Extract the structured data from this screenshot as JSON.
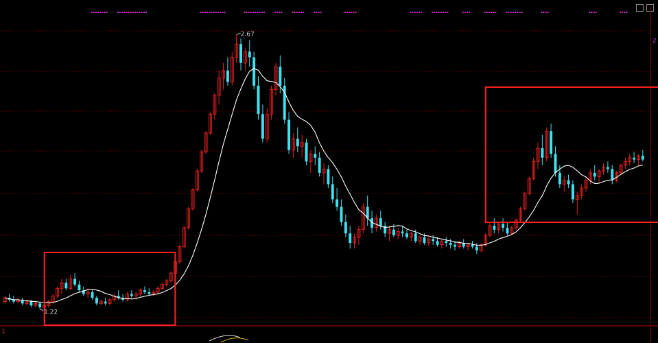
{
  "colors": {
    "background": "#000000",
    "up": "#e02020",
    "down": "#3fe0f0",
    "ma": "#ffffff",
    "grid": "#7a0000",
    "highlight_box": "#ff2020",
    "signal_dots": "#d030d0"
  },
  "chart_data": {
    "type": "candlestick",
    "annotations": {
      "high_label": "2.67",
      "low_label": "1.22"
    },
    "ylim": [
      1.15,
      2.78
    ],
    "highlight_boxes": [
      {
        "label": "",
        "x_range_start": 10,
        "x_range_end": 38
      },
      {
        "label": "",
        "x_range_start": 111,
        "x_range_end": 150
      }
    ],
    "corner_marks": {
      "bottom_left": "1",
      "right_edge": "2"
    },
    "ohlc": [
      [
        1.26,
        1.29,
        1.25,
        1.28
      ],
      [
        1.28,
        1.3,
        1.26,
        1.27
      ],
      [
        1.27,
        1.29,
        1.25,
        1.26
      ],
      [
        1.26,
        1.28,
        1.25,
        1.27
      ],
      [
        1.27,
        1.28,
        1.24,
        1.25
      ],
      [
        1.25,
        1.27,
        1.24,
        1.26
      ],
      [
        1.26,
        1.27,
        1.23,
        1.24
      ],
      [
        1.24,
        1.26,
        1.23,
        1.25
      ],
      [
        1.25,
        1.26,
        1.22,
        1.23
      ],
      [
        1.23,
        1.25,
        1.22,
        1.24
      ],
      [
        1.24,
        1.27,
        1.23,
        1.26
      ],
      [
        1.26,
        1.3,
        1.25,
        1.29
      ],
      [
        1.29,
        1.34,
        1.28,
        1.33
      ],
      [
        1.33,
        1.38,
        1.3,
        1.36
      ],
      [
        1.36,
        1.38,
        1.32,
        1.33
      ],
      [
        1.33,
        1.4,
        1.32,
        1.38
      ],
      [
        1.38,
        1.41,
        1.34,
        1.35
      ],
      [
        1.35,
        1.37,
        1.31,
        1.32
      ],
      [
        1.32,
        1.34,
        1.29,
        1.3
      ],
      [
        1.3,
        1.33,
        1.28,
        1.31
      ],
      [
        1.31,
        1.32,
        1.27,
        1.28
      ],
      [
        1.28,
        1.29,
        1.24,
        1.25
      ],
      [
        1.25,
        1.27,
        1.24,
        1.26
      ],
      [
        1.26,
        1.28,
        1.24,
        1.25
      ],
      [
        1.25,
        1.28,
        1.24,
        1.27
      ],
      [
        1.27,
        1.3,
        1.26,
        1.29
      ],
      [
        1.29,
        1.32,
        1.27,
        1.28
      ],
      [
        1.28,
        1.3,
        1.26,
        1.27
      ],
      [
        1.27,
        1.31,
        1.26,
        1.3
      ],
      [
        1.3,
        1.32,
        1.28,
        1.29
      ],
      [
        1.29,
        1.31,
        1.27,
        1.3
      ],
      [
        1.3,
        1.33,
        1.29,
        1.32
      ],
      [
        1.32,
        1.34,
        1.3,
        1.31
      ],
      [
        1.31,
        1.33,
        1.29,
        1.3
      ],
      [
        1.3,
        1.32,
        1.29,
        1.31
      ],
      [
        1.31,
        1.34,
        1.3,
        1.33
      ],
      [
        1.33,
        1.36,
        1.32,
        1.35
      ],
      [
        1.35,
        1.38,
        1.34,
        1.37
      ],
      [
        1.37,
        1.42,
        1.36,
        1.41
      ],
      [
        1.41,
        1.48,
        1.4,
        1.47
      ],
      [
        1.47,
        1.56,
        1.46,
        1.55
      ],
      [
        1.55,
        1.66,
        1.54,
        1.65
      ],
      [
        1.65,
        1.76,
        1.64,
        1.75
      ],
      [
        1.75,
        1.86,
        1.74,
        1.85
      ],
      [
        1.85,
        1.96,
        1.84,
        1.95
      ],
      [
        1.95,
        2.06,
        1.94,
        2.05
      ],
      [
        2.05,
        2.16,
        2.04,
        2.15
      ],
      [
        2.15,
        2.26,
        2.14,
        2.25
      ],
      [
        2.25,
        2.36,
        2.22,
        2.35
      ],
      [
        2.35,
        2.48,
        2.3,
        2.44
      ],
      [
        2.44,
        2.52,
        2.38,
        2.48
      ],
      [
        2.48,
        2.55,
        2.4,
        2.42
      ],
      [
        2.42,
        2.58,
        2.4,
        2.55
      ],
      [
        2.55,
        2.67,
        2.52,
        2.62
      ],
      [
        2.62,
        2.65,
        2.48,
        2.52
      ],
      [
        2.52,
        2.6,
        2.48,
        2.58
      ],
      [
        2.58,
        2.64,
        2.5,
        2.55
      ],
      [
        2.55,
        2.58,
        2.38,
        2.4
      ],
      [
        2.4,
        2.45,
        2.22,
        2.25
      ],
      [
        2.25,
        2.3,
        2.1,
        2.12
      ],
      [
        2.12,
        2.28,
        2.1,
        2.25
      ],
      [
        2.25,
        2.4,
        2.22,
        2.38
      ],
      [
        2.38,
        2.52,
        2.35,
        2.5
      ],
      [
        2.5,
        2.56,
        2.36,
        2.4
      ],
      [
        2.4,
        2.44,
        2.2,
        2.22
      ],
      [
        2.22,
        2.26,
        2.04,
        2.06
      ],
      [
        2.06,
        2.15,
        2.02,
        2.12
      ],
      [
        2.12,
        2.18,
        2.05,
        2.08
      ],
      [
        2.08,
        2.14,
        2.02,
        2.1
      ],
      [
        2.1,
        2.12,
        1.98,
        2.0
      ],
      [
        2.0,
        2.06,
        1.94,
        2.04
      ],
      [
        2.04,
        2.08,
        1.98,
        2.02
      ],
      [
        2.02,
        2.05,
        1.92,
        1.94
      ],
      [
        1.94,
        1.99,
        1.88,
        1.96
      ],
      [
        1.96,
        1.98,
        1.86,
        1.88
      ],
      [
        1.88,
        1.92,
        1.78,
        1.8
      ],
      [
        1.8,
        1.86,
        1.74,
        1.76
      ],
      [
        1.76,
        1.8,
        1.66,
        1.68
      ],
      [
        1.68,
        1.72,
        1.6,
        1.62
      ],
      [
        1.62,
        1.66,
        1.54,
        1.57
      ],
      [
        1.57,
        1.62,
        1.54,
        1.6
      ],
      [
        1.6,
        1.66,
        1.56,
        1.64
      ],
      [
        1.64,
        1.78,
        1.62,
        1.76
      ],
      [
        1.76,
        1.82,
        1.66,
        1.7
      ],
      [
        1.7,
        1.74,
        1.62,
        1.65
      ],
      [
        1.65,
        1.72,
        1.63,
        1.7
      ],
      [
        1.7,
        1.74,
        1.64,
        1.66
      ],
      [
        1.66,
        1.68,
        1.6,
        1.62
      ],
      [
        1.62,
        1.66,
        1.58,
        1.64
      ],
      [
        1.64,
        1.67,
        1.6,
        1.61
      ],
      [
        1.61,
        1.65,
        1.59,
        1.63
      ],
      [
        1.63,
        1.66,
        1.6,
        1.62
      ],
      [
        1.62,
        1.64,
        1.59,
        1.6
      ],
      [
        1.6,
        1.63,
        1.58,
        1.62
      ],
      [
        1.62,
        1.64,
        1.57,
        1.58
      ],
      [
        1.58,
        1.61,
        1.56,
        1.6
      ],
      [
        1.6,
        1.62,
        1.56,
        1.57
      ],
      [
        1.57,
        1.6,
        1.55,
        1.59
      ],
      [
        1.59,
        1.61,
        1.56,
        1.58
      ],
      [
        1.58,
        1.6,
        1.55,
        1.56
      ],
      [
        1.56,
        1.59,
        1.54,
        1.58
      ],
      [
        1.58,
        1.6,
        1.55,
        1.57
      ],
      [
        1.57,
        1.59,
        1.54,
        1.56
      ],
      [
        1.56,
        1.58,
        1.53,
        1.55
      ],
      [
        1.55,
        1.58,
        1.54,
        1.57
      ],
      [
        1.57,
        1.59,
        1.54,
        1.55
      ],
      [
        1.55,
        1.57,
        1.53,
        1.56
      ],
      [
        1.56,
        1.58,
        1.54,
        1.55
      ],
      [
        1.55,
        1.57,
        1.51,
        1.53
      ],
      [
        1.53,
        1.57,
        1.52,
        1.56
      ],
      [
        1.56,
        1.62,
        1.55,
        1.61
      ],
      [
        1.61,
        1.68,
        1.6,
        1.66
      ],
      [
        1.66,
        1.7,
        1.62,
        1.64
      ],
      [
        1.64,
        1.68,
        1.62,
        1.67
      ],
      [
        1.67,
        1.7,
        1.63,
        1.65
      ],
      [
        1.65,
        1.68,
        1.61,
        1.62
      ],
      [
        1.62,
        1.66,
        1.61,
        1.65
      ],
      [
        1.65,
        1.7,
        1.64,
        1.69
      ],
      [
        1.69,
        1.76,
        1.68,
        1.75
      ],
      [
        1.75,
        1.84,
        1.74,
        1.83
      ],
      [
        1.83,
        1.92,
        1.82,
        1.91
      ],
      [
        1.91,
        2.02,
        1.9,
        2.0
      ],
      [
        2.0,
        2.1,
        1.96,
        2.07
      ],
      [
        2.07,
        2.14,
        1.98,
        2.02
      ],
      [
        2.02,
        2.18,
        2.0,
        2.16
      ],
      [
        2.16,
        2.2,
        2.02,
        2.04
      ],
      [
        2.04,
        2.08,
        1.92,
        1.94
      ],
      [
        1.94,
        1.98,
        1.86,
        1.88
      ],
      [
        1.88,
        1.92,
        1.84,
        1.9
      ],
      [
        1.9,
        1.93,
        1.86,
        1.88
      ],
      [
        1.88,
        1.9,
        1.78,
        1.8
      ],
      [
        1.8,
        1.84,
        1.72,
        1.82
      ],
      [
        1.82,
        1.88,
        1.8,
        1.86
      ],
      [
        1.86,
        1.92,
        1.84,
        1.9
      ],
      [
        1.9,
        1.96,
        1.88,
        1.94
      ],
      [
        1.94,
        1.98,
        1.9,
        1.92
      ],
      [
        1.92,
        1.96,
        1.89,
        1.95
      ],
      [
        1.95,
        1.99,
        1.93,
        1.97
      ],
      [
        1.97,
        2.0,
        1.94,
        1.96
      ],
      [
        1.96,
        1.98,
        1.88,
        1.9
      ],
      [
        1.9,
        1.95,
        1.89,
        1.94
      ],
      [
        1.94,
        1.99,
        1.93,
        1.98
      ],
      [
        1.98,
        2.02,
        1.96,
        2.0
      ],
      [
        2.0,
        2.04,
        1.98,
        2.02
      ],
      [
        2.02,
        2.05,
        1.99,
        2.01
      ],
      [
        2.01,
        2.04,
        1.98,
        2.03
      ],
      [
        2.03,
        2.06,
        2.0,
        2.01
      ]
    ],
    "ma_period": 10,
    "signal_dot_runs": [
      [
        20,
        23
      ],
      [
        26,
        29
      ],
      [
        30,
        32
      ],
      [
        45,
        47
      ],
      [
        48,
        50
      ],
      [
        55,
        57
      ],
      [
        58,
        59
      ],
      [
        62,
        63
      ],
      [
        66,
        68
      ],
      [
        71,
        72
      ],
      [
        78,
        80
      ],
      [
        93,
        95
      ],
      [
        98,
        99
      ],
      [
        100,
        101
      ],
      [
        105,
        106
      ],
      [
        110,
        112
      ],
      [
        115,
        118
      ],
      [
        123,
        124
      ],
      [
        134,
        135
      ],
      [
        141,
        142
      ]
    ],
    "bottom_curve": true
  }
}
